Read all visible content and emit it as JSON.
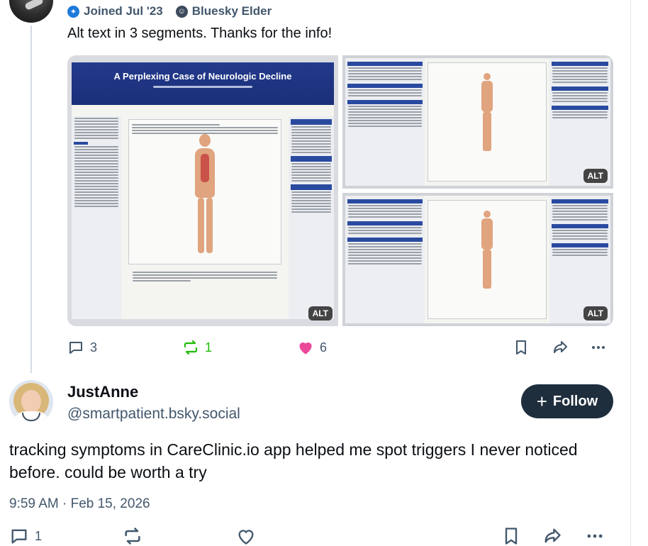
{
  "top_post": {
    "joined_label": "Joined Jul '23",
    "badge_label": "Bluesky Elder",
    "text": "Alt text in 3 segments. Thanks for the info!",
    "images": [
      {
        "poster_title": "A Perplexing Case of Neurologic Decline",
        "alt_badge": "ALT"
      },
      {
        "alt_badge": "ALT"
      },
      {
        "alt_badge": "ALT"
      }
    ],
    "actions": {
      "replies": "3",
      "reposts": "1",
      "likes": "6"
    }
  },
  "reply": {
    "display_name": "JustAnne",
    "handle": "@smartpatient.bsky.social",
    "follow_label": "Follow",
    "text": "tracking symptoms in CareClinic.io app helped me spot triggers I never noticed before. could be worth a try",
    "timestamp": "9:59 AM · Feb 15, 2026",
    "actions": {
      "replies": "1"
    }
  },
  "colors": {
    "muted": "#42576c",
    "repost_active": "#20bc07",
    "like_active": "#ec4899",
    "follow_bg": "#1f2e3d",
    "badge_blue": "#1d7bd9"
  }
}
